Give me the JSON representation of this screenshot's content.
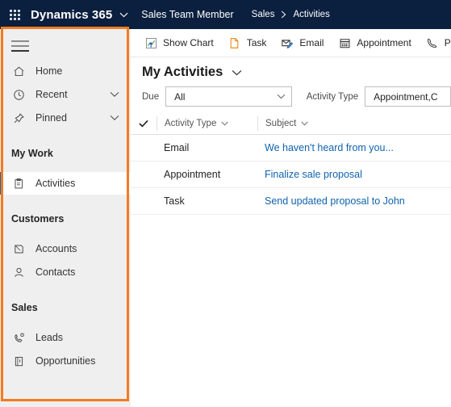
{
  "header": {
    "waffle_icon": "app-launcher-icon",
    "brand": "Dynamics 365",
    "brand_caret_icon": "chevron-down-icon",
    "app_name": "Sales Team Member",
    "breadcrumb": {
      "parent": "Sales",
      "separator_icon": "chevron-right-icon",
      "current": "Activities"
    }
  },
  "sidebar": {
    "menu_icon": "hamburger-icon",
    "items": [
      {
        "label": "Home",
        "icon": "home-icon",
        "has_chevron": false,
        "selected": false
      },
      {
        "label": "Recent",
        "icon": "clock-icon",
        "has_chevron": true,
        "selected": false
      },
      {
        "label": "Pinned",
        "icon": "pin-icon",
        "has_chevron": true,
        "selected": false
      }
    ],
    "groups": [
      {
        "title": "My Work",
        "items": [
          {
            "label": "Activities",
            "icon": "clipboard-icon",
            "selected": true
          }
        ]
      },
      {
        "title": "Customers",
        "items": [
          {
            "label": "Accounts",
            "icon": "account-icon",
            "selected": false
          },
          {
            "label": "Contacts",
            "icon": "contact-icon",
            "selected": false
          }
        ]
      },
      {
        "title": "Sales",
        "items": [
          {
            "label": "Leads",
            "icon": "lead-phone-icon",
            "selected": false
          },
          {
            "label": "Opportunities",
            "icon": "opportunity-icon",
            "selected": false
          }
        ]
      }
    ]
  },
  "commandbar": {
    "buttons": [
      {
        "label": "Show Chart",
        "icon": "show-chart-icon"
      },
      {
        "label": "Task",
        "icon": "task-page-icon"
      },
      {
        "label": "Email",
        "icon": "email-envelope-icon"
      },
      {
        "label": "Appointment",
        "icon": "calendar-icon"
      },
      {
        "label": "Phone Call",
        "icon": "phone-handset-icon"
      }
    ]
  },
  "view": {
    "title": "My Activities",
    "title_caret_icon": "chevron-down-icon",
    "filters": [
      {
        "label": "Due",
        "value": "All",
        "caret_icon": "chevron-down-icon"
      },
      {
        "label": "Activity Type",
        "value": "Appointment,C",
        "caret_icon": "chevron-down-icon"
      }
    ]
  },
  "grid": {
    "select_all_icon": "checkmark-icon",
    "columns": [
      {
        "label": "Activity Type",
        "sort_icon": "chevron-down-icon"
      },
      {
        "label": "Subject",
        "sort_icon": "chevron-down-icon"
      }
    ],
    "rows": [
      {
        "activity_type": "Email",
        "subject": "We haven't heard from you..."
      },
      {
        "activity_type": "Appointment",
        "subject": "Finalize sale proposal"
      },
      {
        "activity_type": "Task",
        "subject": "Send updated proposal to John"
      }
    ]
  },
  "annotation": {
    "highlight_color": "#f47b20"
  }
}
